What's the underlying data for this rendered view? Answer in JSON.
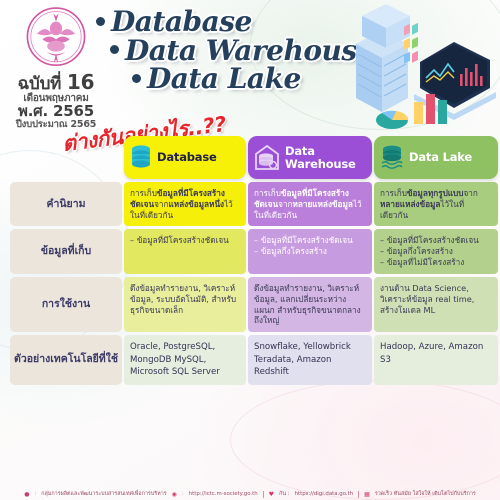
{
  "header": {
    "seal_name": "garuda-seal",
    "issue_label": "ฉบับที่",
    "issue_number": "16",
    "month": "เดือนพฤษภาคม",
    "year": "พ.ศ. 2565",
    "budget_year": "ปีงบประมาณ 2565",
    "title_lines": [
      "Database",
      "Data Warehouse",
      "Data Lake"
    ],
    "subhead": "ต่างกันอย่างไร..??"
  },
  "columns": [
    {
      "key": "database",
      "label": "Database",
      "icon": "database-cylinder-icon",
      "color": "#f7f108"
    },
    {
      "key": "warehouse",
      "label": "Data\nWarehouse",
      "label_line1": "Data",
      "label_line2": "Warehouse",
      "icon": "warehouse-house-icon",
      "color": "#9a4fd6"
    },
    {
      "key": "lake",
      "label": "Data Lake",
      "icon": "data-lake-waves-icon",
      "color": "#8dc162"
    }
  ],
  "rows": [
    {
      "label": "คำนิยาม",
      "database": {
        "segments": [
          {
            "t": "การเก็บ",
            "b": false
          },
          {
            "t": "ข้อมูลที่มีโครงสร้างชัดเจน",
            "b": true
          },
          {
            "t": "จาก",
            "b": false
          },
          {
            "t": "แหล่งข้อมูลหนึ่ง",
            "b": true
          },
          {
            "t": "ไว้ในที่เดียวกัน",
            "b": false
          }
        ]
      },
      "warehouse": {
        "segments": [
          {
            "t": "การเก็บ",
            "b": false
          },
          {
            "t": "ข้อมูลที่มีโครงสร้างชัดเจน",
            "b": true
          },
          {
            "t": "จาก",
            "b": false
          },
          {
            "t": "หลายแหล่งข้อมูล",
            "b": true
          },
          {
            "t": "ไว้ในที่เดียวกัน",
            "b": false
          }
        ]
      },
      "lake": {
        "segments": [
          {
            "t": "การเก็บ",
            "b": false
          },
          {
            "t": "ข้อมูลทุกรูปแบบ",
            "b": true
          },
          {
            "t": "จาก",
            "b": false
          },
          {
            "t": "หลายแหล่งข้อมูล",
            "b": true
          },
          {
            "t": "ไว้ในที่เดียวกัน",
            "b": false
          }
        ]
      }
    },
    {
      "label": "ข้อมูลที่เก็บ",
      "database": {
        "items": [
          "– ข้อมูลที่มีโครงสร้างชัดเจน"
        ]
      },
      "warehouse": {
        "items": [
          "– ข้อมูลที่มีโครงสร้างชัดเจน",
          "– ข้อมูลกึ่งโครงสร้าง"
        ]
      },
      "lake": {
        "items": [
          "– ข้อมูลที่มีโครงสร้างชัดเจน",
          "– ข้อมูลกึ่งโครงสร้าง",
          "– ข้อมูลที่ไม่มีโครงสร้าง"
        ]
      }
    },
    {
      "label": "การใช้งาน",
      "database": {
        "text": "ดึงข้อมูลทำรายงาน, วิเคราะห์ข้อมูล, ระบบอัตโนมัติ, สำหรับธุรกิจขนาดเล็ก"
      },
      "warehouse": {
        "text": "ดึงข้อมูลทำรายงาน, วิเคราะห์ข้อมูล, แลกเปลี่ยนระหว่างแผนก สำหรับธุรกิจขนาดกลางถึงใหญ่"
      },
      "lake": {
        "text": "งานด้าน Data Science, วิเคราะห์ข้อมูล real time, สร้างโมเดล ML"
      }
    },
    {
      "label": "ตัวอย่าง\nเทคโนโลยีที่ใช้",
      "label_line1": "ตัวอย่าง",
      "label_line2": "เทคโนโลยีที่ใช้",
      "database": {
        "text": "Oracle, PostgreSQL, MongoDB MySQL, Microsoft SQL Server"
      },
      "warehouse": {
        "text": "Snowflake, Yellowbrick Teradata, Amazon Redshift"
      },
      "lake": {
        "text": "Hadoop, Azure, Amazon S3"
      }
    }
  ],
  "footer": {
    "org": "กลุ่มการผลิตและพัฒนาระบบสารสนเทศเพื่อการบริหาร",
    "site_label": "http://ictc.m-society.go.th",
    "follow_label": "กัน :",
    "follow_url": "https://digi.data.go.th",
    "note": "รวดเร็ว ทันสมัย ใส่ใจให้ เติบโตไปกับบริการ",
    "pin_icon": "location-pin-icon",
    "globe_icon": "globe-icon",
    "heart_icon": "heart-icon",
    "doc_icon": "document-icon"
  },
  "illustration": {
    "name": "isometric-data-center-analytics",
    "elements": [
      "server-racks",
      "laptop-with-charts",
      "pie-chart",
      "bar-charts"
    ]
  },
  "palette": {
    "title_navy": "#24405c",
    "subhead_red": "#e8252a",
    "database_yellow": "#f7f108",
    "warehouse_purple": "#9a4fd6",
    "lake_green": "#8dc162",
    "rowlabel_beige": "#ebe5dc",
    "seal_pink": "#d44a9a"
  }
}
